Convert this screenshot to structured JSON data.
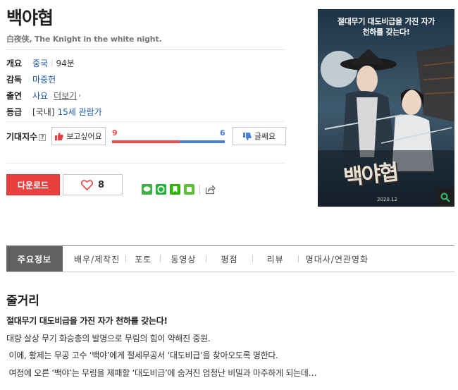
{
  "movie": {
    "title": "백야협",
    "subtitle": "白夜俠, The Knight in the white night."
  },
  "info": {
    "overview_label": "개요",
    "country": "중국",
    "runtime": "94분",
    "director_label": "감독",
    "director": "마중헌",
    "cast_label": "출연",
    "cast": "사요",
    "more": "더보기",
    "rating_label": "등급",
    "rating_region": "[국내]",
    "rating": "15세 관람가"
  },
  "expect": {
    "label": "기대지수",
    "help": "?",
    "want_label": "보고싶어요",
    "want_count": 9,
    "meh_label": "글쎄요",
    "meh_count": 6
  },
  "actions": {
    "download_label": "다운로드",
    "like_count": "8"
  },
  "poster": {
    "tagline_1": "절대무기 대도비급을 가진 자가",
    "tagline_2": "천하를 갖는다!",
    "title": "백야협",
    "date": "2020.12"
  },
  "tabs": [
    "주요정보",
    "배우/제작진",
    "포토",
    "동영상",
    "평점",
    "리뷰",
    "명대사/연관영화"
  ],
  "synopsis": {
    "heading": "줄거리",
    "lead": "절대무기 대도비급을 가진 자가 천하를 갖는다!",
    "line1": "대량 살상 무기 화승총의 발명으로 무림의 힘이 약해진 중원.",
    "line2": " 이에, 황제는 무공 고수 ‘백야’에게 절세무공서 ‘대도비급’을 찾아오도록 명한다.",
    "line3": " 여정에 오른 ‘백야’는 무림을 제패할 ‘대도비급’에 숨겨진 엄청난 비밀과 마주하게 되는데…"
  },
  "colors": {
    "accent_red": "#e8403f",
    "bar_red": "#e8504f",
    "bar_blue": "#4a7fd6",
    "link_blue": "#1a5aa9",
    "tab_active": "#616161"
  }
}
